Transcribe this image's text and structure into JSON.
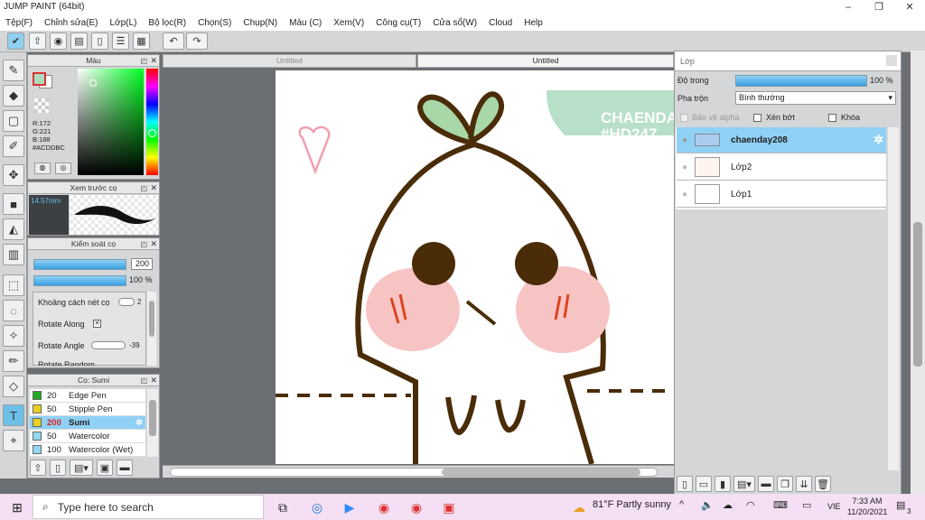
{
  "window": {
    "title": "JUMP PAINT (64bit)",
    "minimize": "–",
    "maximize": "❐",
    "close": "✕"
  },
  "menu": [
    "Tệp(F)",
    "Chỉnh sửa(E)",
    "Lớp(L)",
    "Bộ lọc(R)",
    "Chọn(S)",
    "Chụp(N)",
    "Màu (C)",
    "Xem(V)",
    "Công cụ(T)",
    "Cửa sổ(W)",
    "Cloud",
    "Help"
  ],
  "toolbar": {
    "undo": "↶",
    "redo": "↷"
  },
  "color_panel": {
    "title": "Màu",
    "r": "R:172",
    "g": "G:221",
    "b": "B:188",
    "hex": "#ACDDBC",
    "fg": "#ACDDBC",
    "bg": "#ffffff"
  },
  "brush_preview": {
    "title": "Xem trước cọ",
    "size": "14.57mm"
  },
  "brush_control": {
    "title": "Kiểm soát cọ",
    "size_val": "200",
    "opacity_val": "100 %",
    "spacing_label": "Khoảng cách nét cọ",
    "spacing_val": "2",
    "rotate_along": "Rotate Along",
    "rotate_angle": "Rotate Angle",
    "angle_val": "-39",
    "rotate_random": "Rotate Random"
  },
  "brush_list": {
    "title": "Cọ: Sumi",
    "items": [
      {
        "size": "20",
        "name": "Edge Pen",
        "color": "#22aa22"
      },
      {
        "size": "50",
        "name": "Stipple Pen",
        "color": "#e8d020"
      },
      {
        "size": "200",
        "name": "Sumi",
        "color": "#e8d020",
        "selected": true
      },
      {
        "size": "50",
        "name": "Watercolor",
        "color": "#8fd8f0"
      },
      {
        "size": "100",
        "name": "Watercolor (Wet)",
        "color": "#8fd8f0"
      }
    ]
  },
  "doc_tabs": [
    "Untitled",
    "Untitled"
  ],
  "canvas": {
    "watermark1": "CHAENDAY",
    "watermark2": "#HD247"
  },
  "layers": {
    "title": "Lớp",
    "opacity_label": "Độ trong",
    "opacity_val": "100 %",
    "blend_label": "Pha trộn",
    "blend_val": "Bình thường",
    "protect_alpha": "Bảo vệ alpha",
    "clip": "Xén bớt",
    "lock": "Khóa",
    "items": [
      {
        "name": "chaenday208",
        "selected": true
      },
      {
        "name": "Lớp2"
      },
      {
        "name": "Lớp1"
      }
    ]
  },
  "taskbar": {
    "search_placeholder": "Type here to search",
    "weather": "81°F  Partly sunny",
    "lang": "VIE",
    "time": "7:33 AM",
    "date": "11/20/2021",
    "notif": "3"
  }
}
